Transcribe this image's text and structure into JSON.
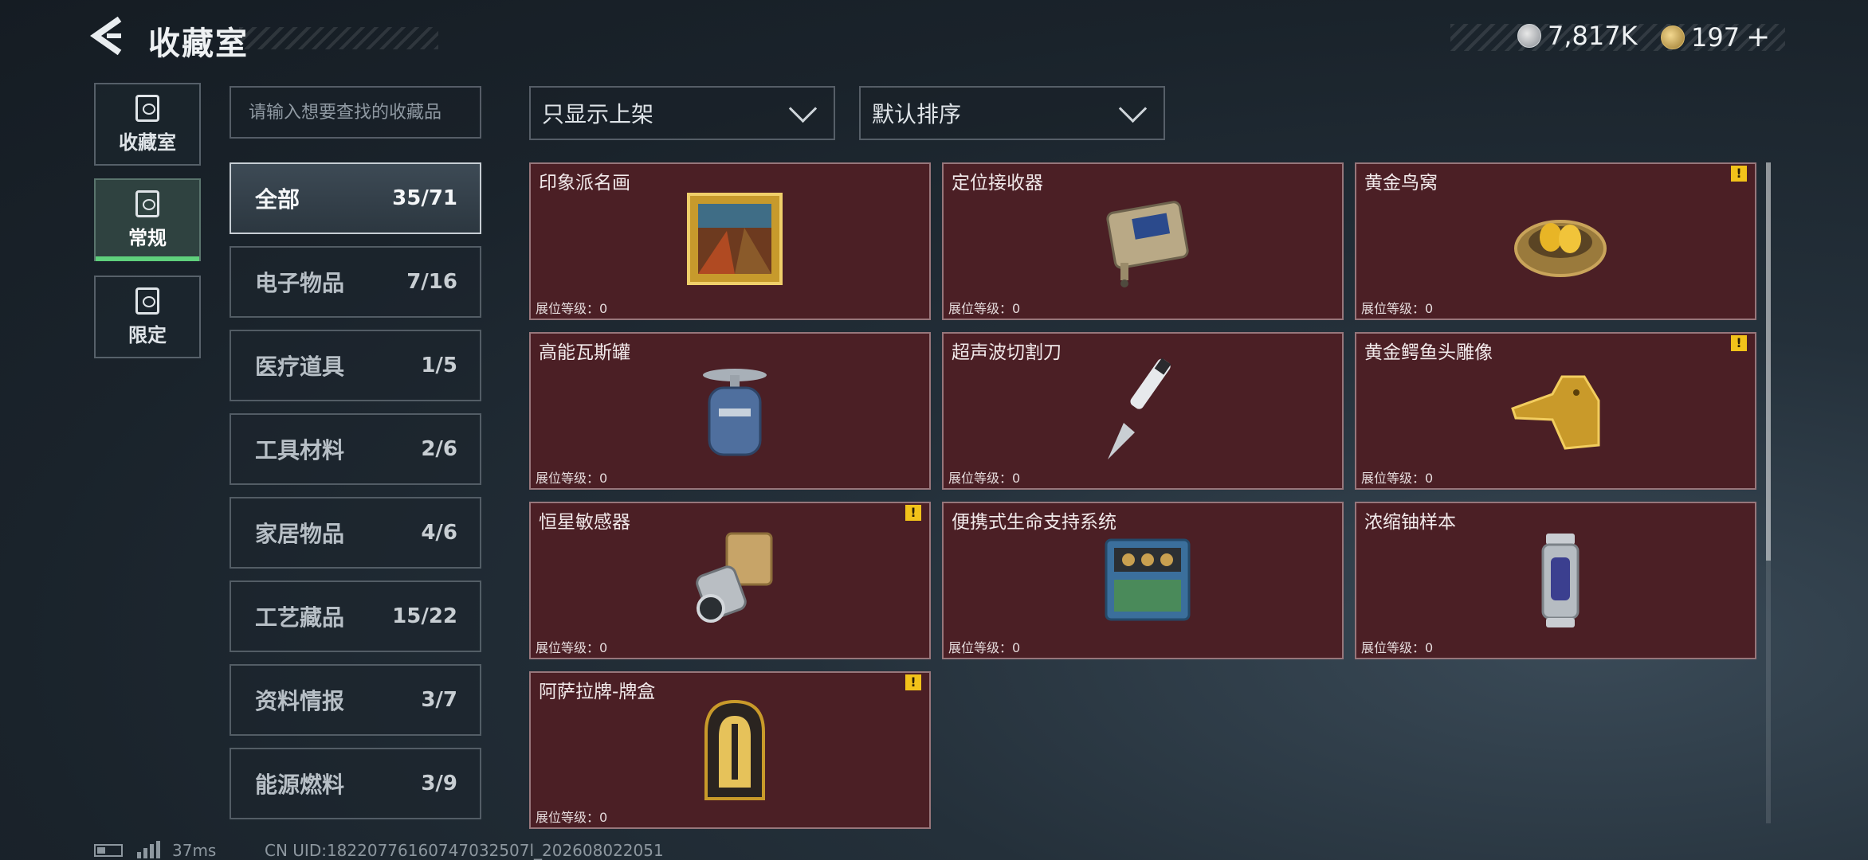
{
  "header": {
    "title": "收藏室",
    "currency_silver": "7,817K",
    "currency_gold": "197",
    "currency_add": "+"
  },
  "nav": [
    {
      "label": "收藏室",
      "icon": "vault-icon"
    },
    {
      "label": "常规",
      "icon": "collection-icon",
      "active": true
    },
    {
      "label": "限定",
      "icon": "picture-icon"
    }
  ],
  "search": {
    "placeholder": "请输入想要查找的收藏品"
  },
  "filters": {
    "display": "只显示上架",
    "sort": "默认排序"
  },
  "categories": [
    {
      "name": "全部",
      "count": "35/71",
      "active": true
    },
    {
      "name": "电子物品",
      "count": "7/16"
    },
    {
      "name": "医疗道具",
      "count": "1/5"
    },
    {
      "name": "工具材料",
      "count": "2/6"
    },
    {
      "name": "家居物品",
      "count": "4/6"
    },
    {
      "name": "工艺藏品",
      "count": "15/22"
    },
    {
      "name": "资料情报",
      "count": "3/7"
    },
    {
      "name": "能源燃料",
      "count": "3/9"
    }
  ],
  "items": [
    {
      "name": "印象派名画",
      "level": "展位等级：0",
      "icon": "painting-icon",
      "warning": false
    },
    {
      "name": "定位接收器",
      "level": "展位等级：0",
      "icon": "receiver-icon",
      "warning": false
    },
    {
      "name": "黄金鸟窝",
      "level": "展位等级：0",
      "icon": "gold-nest-icon",
      "warning": true,
      "warning_text": "!"
    },
    {
      "name": "高能瓦斯罐",
      "level": "展位等级：0",
      "icon": "gas-canister-icon",
      "warning": false
    },
    {
      "name": "超声波切割刀",
      "level": "展位等级：0",
      "icon": "ultrasonic-knife-icon",
      "warning": false
    },
    {
      "name": "黄金鳄鱼头雕像",
      "level": "展位等级：0",
      "icon": "gold-crocodile-icon",
      "warning": true,
      "warning_text": "!"
    },
    {
      "name": "恒星敏感器",
      "level": "展位等级：0",
      "icon": "star-sensor-icon",
      "warning": true,
      "warning_text": "!"
    },
    {
      "name": "便携式生命支持系统",
      "level": "展位等级：0",
      "icon": "life-support-icon",
      "warning": false
    },
    {
      "name": "浓缩铀样本",
      "level": "展位等级：0",
      "icon": "uranium-sample-icon",
      "warning": false
    },
    {
      "name": "阿萨拉牌-牌盒",
      "level": "展位等级：0",
      "icon": "card-box-icon",
      "warning": true,
      "warning_text": "!"
    }
  ],
  "footer": {
    "ping": "37ms",
    "uid": "CN UID:18220776160747032507l_202608022051"
  },
  "colors": {
    "card_bg": "#4b1f25",
    "active_nav_accent": "#5fd07c",
    "warning": "#f2c21a"
  }
}
